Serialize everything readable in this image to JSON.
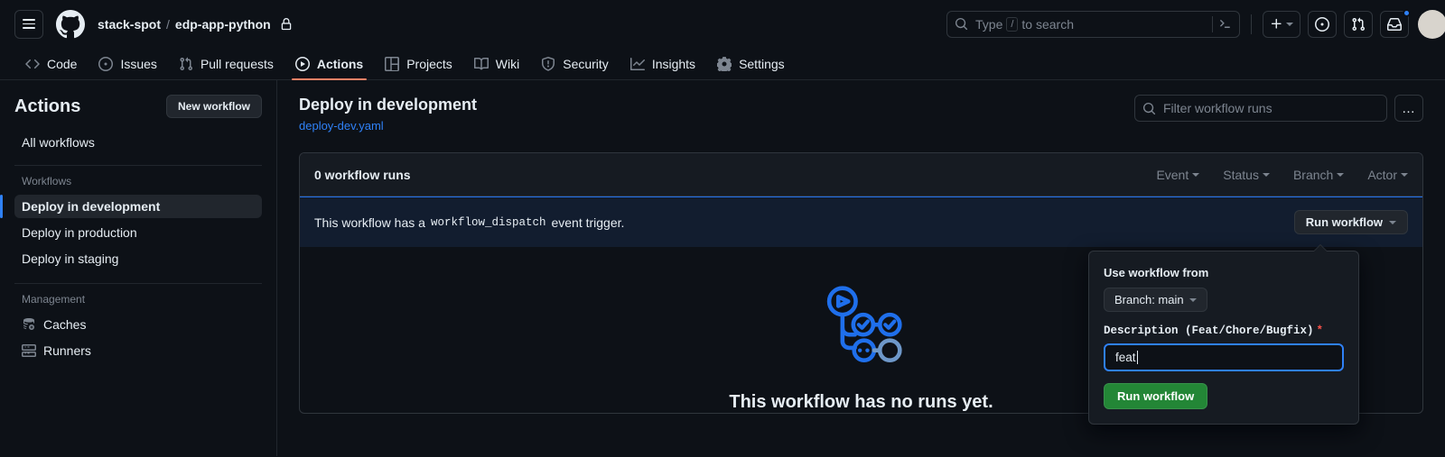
{
  "header": {
    "menu_icon": "hamburger-menu-icon",
    "logo_icon": "github-logo-icon",
    "owner": "stack-spot",
    "separator": "/",
    "repo": "edp-app-python",
    "visibility_icon": "lock-icon",
    "search": {
      "placeholder_prefix": "Type",
      "placeholder_key": "/",
      "placeholder_suffix": "to search",
      "search_icon": "search-icon",
      "terminal_icon": "terminal-icon"
    },
    "actions": {
      "create_new": "plus-icon",
      "create_new_caret": "chevron-down-icon",
      "issues_icon": "issue-opened-icon",
      "pull_requests_icon": "git-pull-request-icon",
      "notifications_icon": "inbox-icon",
      "avatar": "user-avatar"
    }
  },
  "repo_nav": {
    "tabs": [
      {
        "label": "Code",
        "icon": "code-icon",
        "selected": false
      },
      {
        "label": "Issues",
        "icon": "issue-opened-icon",
        "selected": false
      },
      {
        "label": "Pull requests",
        "icon": "git-pull-request-icon",
        "selected": false
      },
      {
        "label": "Actions",
        "icon": "play-icon",
        "selected": true
      },
      {
        "label": "Projects",
        "icon": "table-icon",
        "selected": false
      },
      {
        "label": "Wiki",
        "icon": "book-icon",
        "selected": false
      },
      {
        "label": "Security",
        "icon": "shield-icon",
        "selected": false
      },
      {
        "label": "Insights",
        "icon": "graph-icon",
        "selected": false
      },
      {
        "label": "Settings",
        "icon": "gear-icon",
        "selected": false
      }
    ]
  },
  "sidebar": {
    "title": "Actions",
    "new_workflow_button": "New workflow",
    "all_workflows": "All workflows",
    "workflows_group_label": "Workflows",
    "workflows": [
      {
        "label": "Deploy in development",
        "active": true
      },
      {
        "label": "Deploy in production",
        "active": false
      },
      {
        "label": "Deploy in staging",
        "active": false
      }
    ],
    "management_group_label": "Management",
    "management": [
      {
        "label": "Caches",
        "icon": "cache-icon"
      },
      {
        "label": "Runners",
        "icon": "server-icon"
      }
    ]
  },
  "main": {
    "workflow_title": "Deploy in development",
    "workflow_file": "deploy-dev.yaml",
    "filter_placeholder": "Filter workflow runs",
    "filter_search_icon": "search-icon",
    "overflow_menu": "…",
    "runs_count_label": "0 workflow runs",
    "run_filters": [
      {
        "label": "Event"
      },
      {
        "label": "Status"
      },
      {
        "label": "Branch"
      },
      {
        "label": "Actor"
      }
    ],
    "dispatch_notice": {
      "prefix": "This workflow has a",
      "code": "workflow_dispatch",
      "suffix": "event trigger.",
      "run_workflow_button": "Run workflow",
      "run_workflow_caret": "chevron-down-icon"
    },
    "empty_state": {
      "illustration": "workflow-graph-illustration",
      "title": "This workflow has no runs yet."
    }
  },
  "popover": {
    "use_workflow_from_label": "Use workflow from",
    "branch_button": "Branch: main",
    "branch_caret": "chevron-down-icon",
    "description_label": "Description (Feat/Chore/Bugfix)",
    "required_marker": "*",
    "description_value": "feat",
    "submit_button": "Run workflow"
  },
  "colors": {
    "page_bg": "#0d1117",
    "panel_bg": "#161b22",
    "border": "#30363d",
    "accent_blue": "#2f81f7",
    "accent_orange": "#f78166",
    "green_button": "#238636",
    "required_red": "#f85149",
    "muted_text": "#7d8590",
    "dispatch_bg": "#121d2f"
  }
}
